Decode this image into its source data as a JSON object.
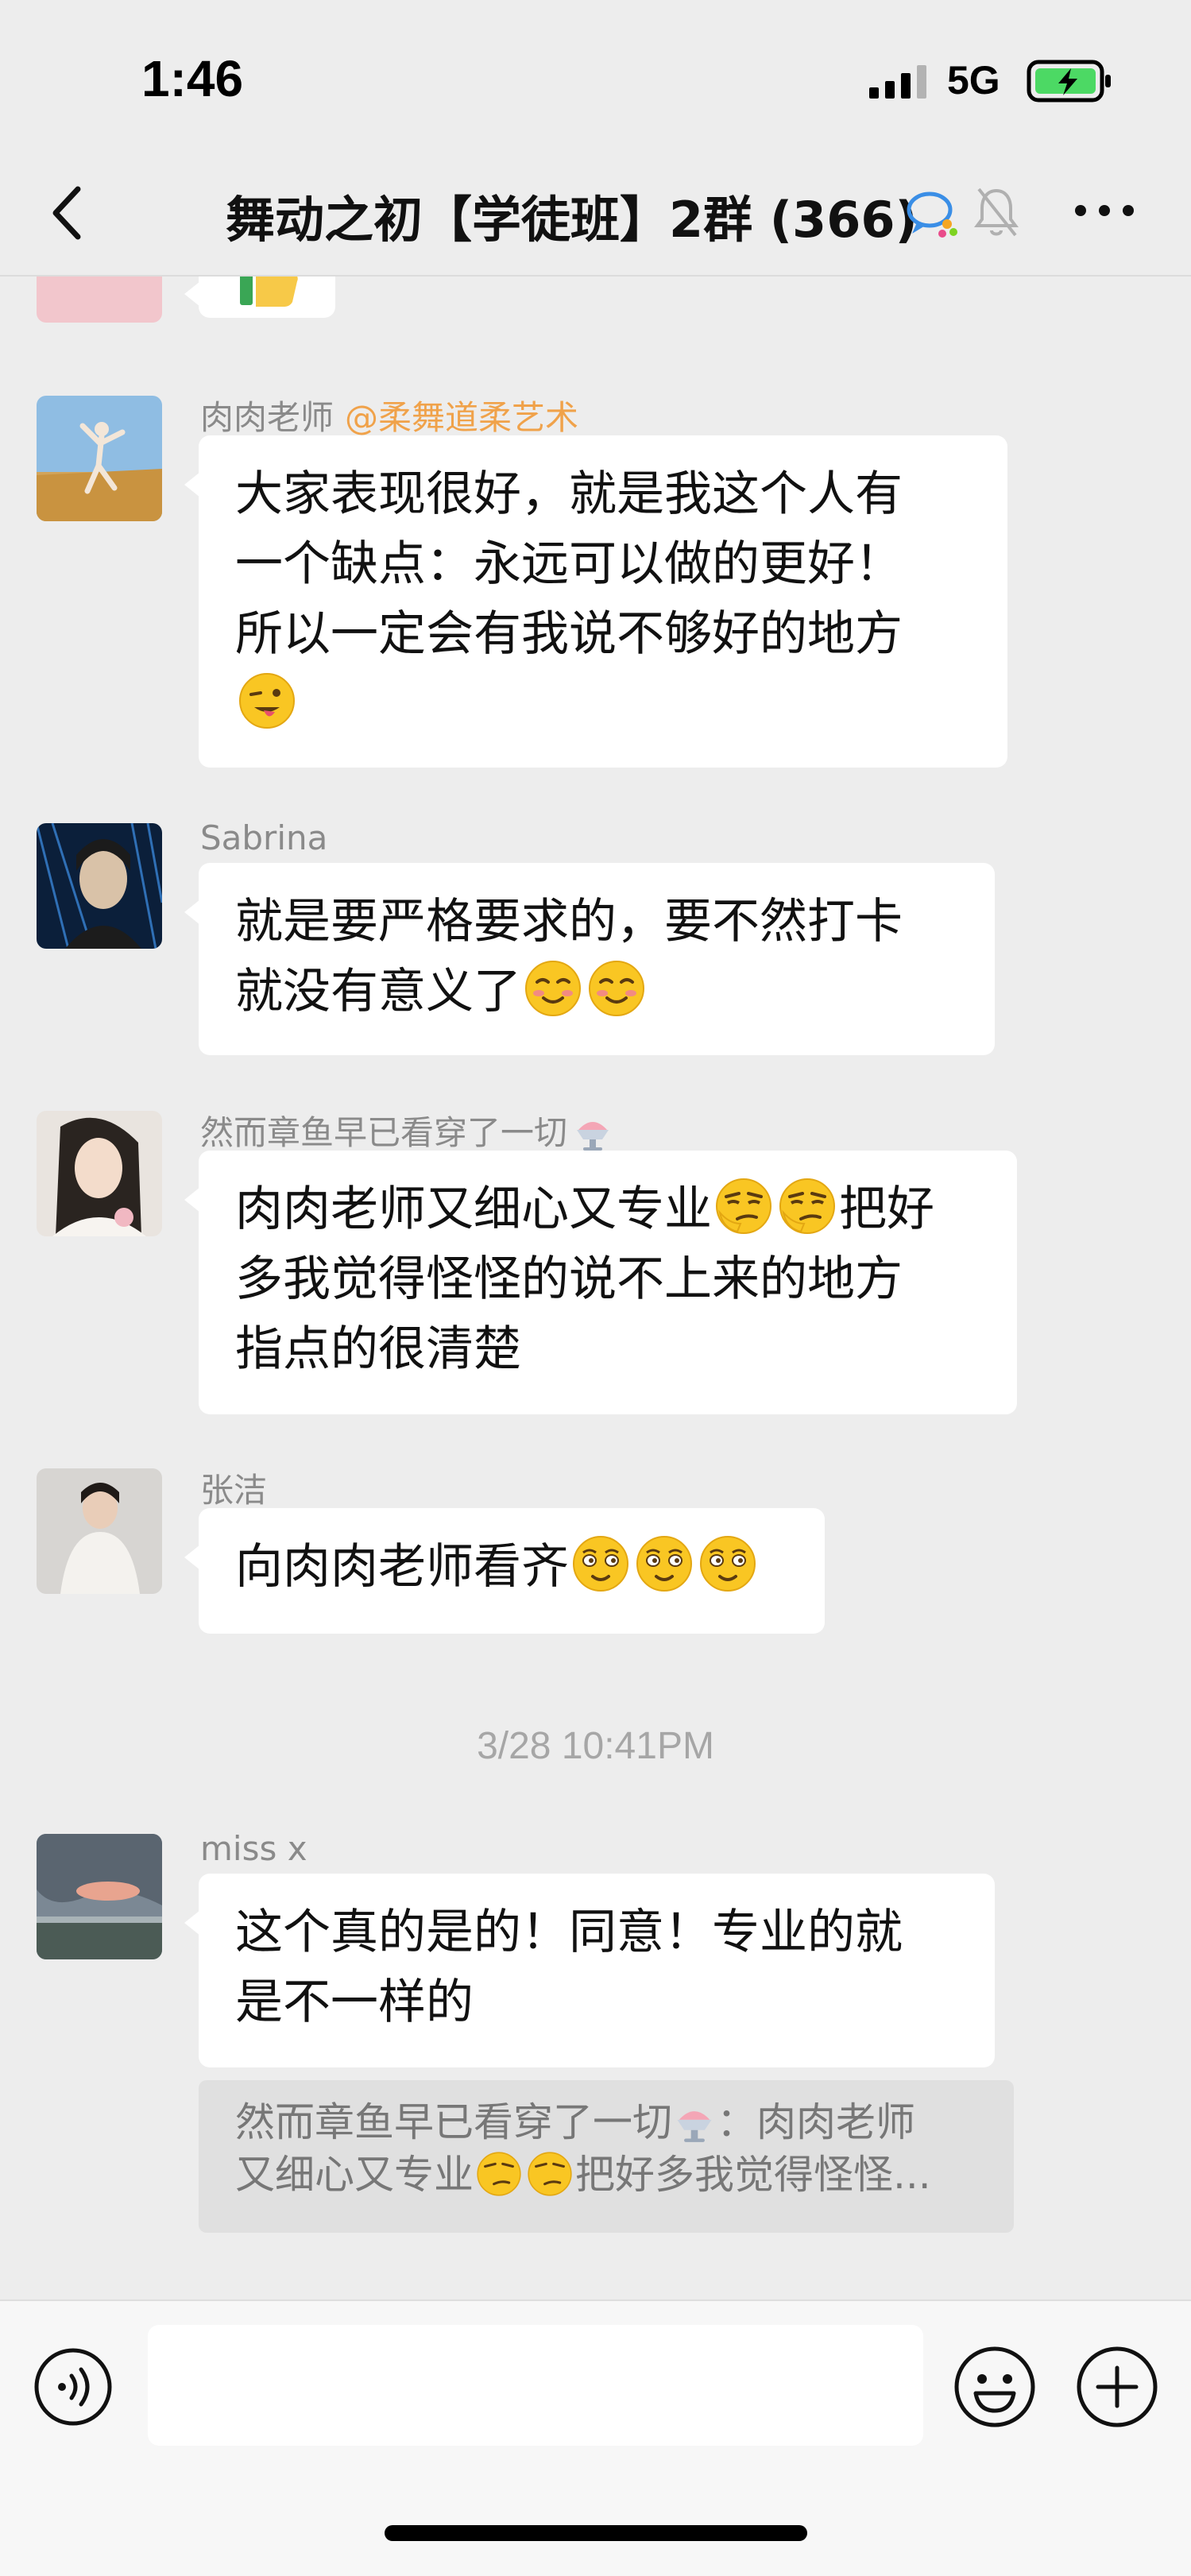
{
  "status_bar": {
    "time": "1:46",
    "network": "5G"
  },
  "nav": {
    "title": "舞动之初【学徒班】2群 (366)"
  },
  "messages": [
    {
      "sender": "肉肉老师",
      "sender_tag": "@柔舞道柔艺术",
      "lines": [
        "大家表现很好，就是我这个人有",
        "一个缺点：永远可以做的更好！",
        "所以一定会有我说不够好的地方"
      ]
    },
    {
      "sender": "Sabrina",
      "lines": [
        "就是要严格要求的，要不然打卡",
        "就没有意义了"
      ]
    },
    {
      "sender": "然而章鱼早已看穿了一切",
      "lines": [
        "肉肉老师又细心又专业",
        "把好",
        "多我觉得怪怪的说不上来的地方",
        "指点的很清楚"
      ]
    },
    {
      "sender": "张洁",
      "lines": [
        "向肉肉老师看齐"
      ]
    },
    {
      "sender": "miss x",
      "lines": [
        "这个真的是的！同意！专业的就",
        "是不一样的"
      ]
    }
  ],
  "time_separator": "3/28 10:41PM",
  "quote": {
    "line1_a": "然而章鱼早已看穿了一切",
    "line1_b": "：肉肉老师",
    "line2_a": "又细心又专业",
    "line2_b": "把好多我觉得怪怪..."
  },
  "input": {
    "placeholder": ""
  },
  "colors": {
    "background": "#ededed",
    "bubble": "#ffffff",
    "sender_tag": "#f0a24a",
    "battery": "#4cd964"
  }
}
